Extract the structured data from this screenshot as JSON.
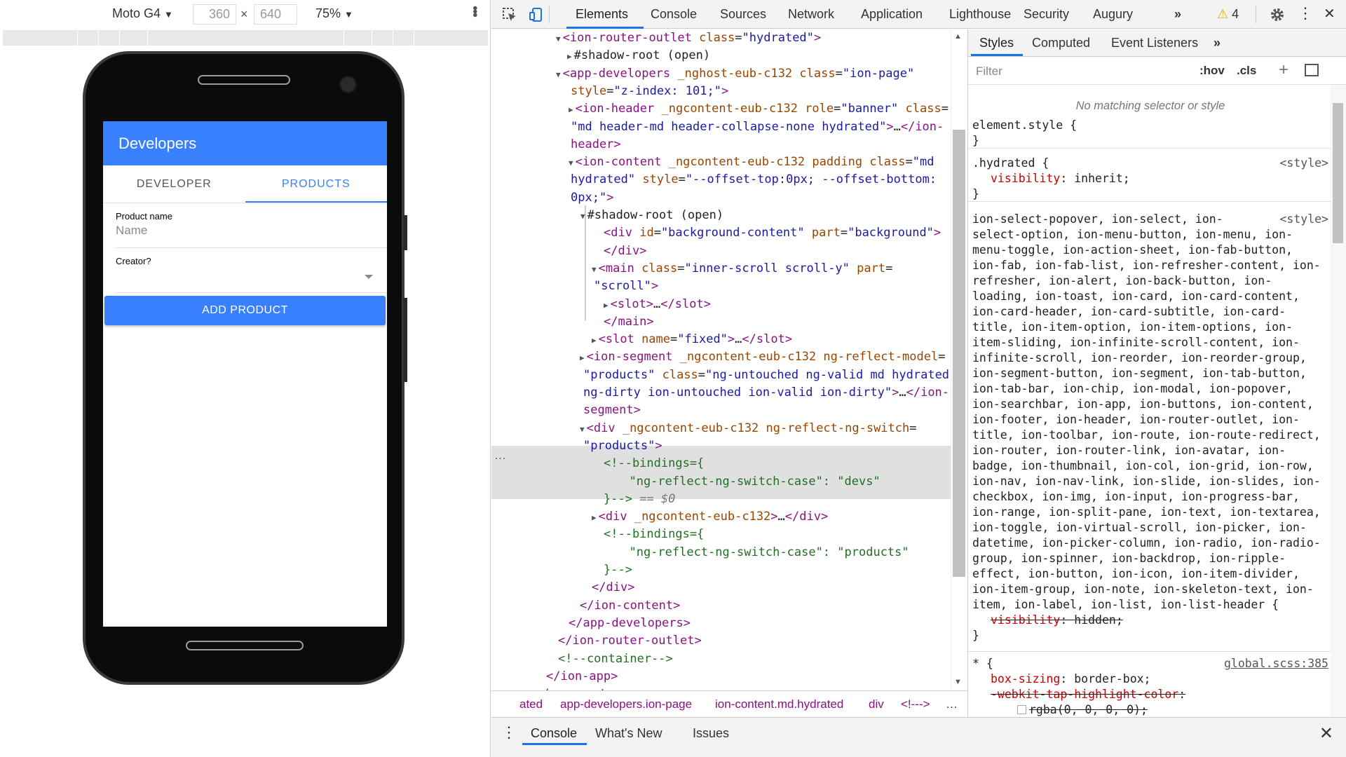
{
  "device_toolbar": {
    "device": "Moto G4",
    "width": "360",
    "height": "640",
    "times": "×",
    "zoom": "75%",
    "caret": "▼",
    "kebab": "•••"
  },
  "app": {
    "title": "Developers",
    "segments": [
      "DEVELOPER",
      "PRODUCTS"
    ],
    "product_name_label": "Product name",
    "product_name_placeholder": "Name",
    "creator_label": "Creator?",
    "add_button": "ADD PRODUCT",
    "accent": "#3880ff"
  },
  "devtools": {
    "tabs": [
      "Elements",
      "Console",
      "Sources",
      "Network",
      "Application",
      "Lighthouse",
      "Security",
      "Augury"
    ],
    "more": "»",
    "warning_icon": "⚠",
    "warning_count": "4",
    "menu_icon": "⋮",
    "close": "✕"
  },
  "elements_rows": [
    {
      "html": "<span class='tri-d'></span><span class='tag'>&lt;ion-router-outlet</span> <span class='attr'>class</span>=<span class='aval'>\"hydrated\"</span><span class='tag'>&gt;</span>"
    },
    {
      "html": "<span class='tri-r'></span>#shadow-root (open)"
    },
    {
      "html": "<span class='tri-d'></span><span class='tag'>&lt;app-developers</span> <span class='attr'>_nghost-eub-c132</span> <span class='attr'>class</span>=<span class='aval'>\"ion-page\"</span>"
    },
    {
      "html": "<span class='attr'>style</span>=<span class='aval'>\"z-index: 101;\"</span><span class='tag'>&gt;</span>"
    },
    {
      "html": "<span class='tri-r'></span><span class='tag'>&lt;ion-header</span> <span class='attr'>_ngcontent-eub-c132</span> <span class='attr'>role</span>=<span class='aval'>\"banner\"</span> <span class='attr'>class</span>="
    },
    {
      "html": "<span class='aval'>\"md header-md header-collapse-none hydrated\"</span><span class='tag'>&gt;</span>…<span class='tag'>&lt;/ion-</span>"
    },
    {
      "html": "<span class='tag'>header&gt;</span>"
    },
    {
      "html": "<span class='tri-d'></span><span class='tag'>&lt;ion-content</span> <span class='attr'>_ngcontent-eub-c132</span> <span class='attr'>padding</span> <span class='attr'>class</span>=<span class='aval'>\"md</span>"
    },
    {
      "html": "<span class='aval'>hydrated\"</span> <span class='attr'>style</span>=<span class='aval'>\"--offset-top:0px; --offset-bottom:</span>"
    },
    {
      "html": "<span class='aval'>0px;\"</span><span class='tag'>&gt;</span>"
    },
    {
      "html": "<span class='tri-d'></span>#shadow-root (open)"
    },
    {
      "html": "<span class='tag'>&lt;div</span> <span class='attr'>id</span>=<span class='aval'>\"background-content\"</span> <span class='attr'>part</span>=<span class='aval'>\"background\"</span><span class='tag'>&gt;</span>"
    },
    {
      "html": "<span class='tag'>&lt;/div&gt;</span>"
    },
    {
      "html": "<span class='tri-d'></span><span class='tag'>&lt;main</span> <span class='attr'>class</span>=<span class='aval'>\"inner-scroll scroll-y\"</span> <span class='attr'>part</span>="
    },
    {
      "html": "<span class='aval'>\"scroll\"</span><span class='tag'>&gt;</span>"
    },
    {
      "html": "<span class='tri-r'></span><span class='tag'>&lt;slot&gt;</span>…<span class='tag'>&lt;/slot&gt;</span>"
    },
    {
      "html": "<span class='tag'>&lt;/main&gt;</span>"
    },
    {
      "html": "<span class='tri-r'></span><span class='tag'>&lt;slot</span> <span class='attr'>name</span>=<span class='aval'>\"fixed\"</span><span class='tag'>&gt;</span>…<span class='tag'>&lt;/slot&gt;</span>"
    },
    {
      "html": "<span class='tri-r'></span><span class='tag'>&lt;ion-segment</span> <span class='attr'>_ngcontent-eub-c132</span> <span class='attr'>ng-reflect-model</span>="
    },
    {
      "html": "<span class='aval'>\"products\"</span> <span class='attr'>class</span>=<span class='aval'>\"ng-untouched ng-valid md hydrated</span>"
    },
    {
      "html": "<span class='aval'>ng-dirty ion-untouched ion-valid ion-dirty\"</span><span class='tag'>&gt;</span>…<span class='tag'>&lt;/ion-</span>"
    },
    {
      "html": "<span class='tag'>segment&gt;</span>"
    },
    {
      "html": "<span class='tri-d'></span><span class='tag'>&lt;div</span> <span class='attr'>_ngcontent-eub-c132</span> <span class='attr'>ng-reflect-ng-switch</span>="
    },
    {
      "html": "<span class='aval'>\"products\"</span><span class='tag'>&gt;</span>"
    },
    {
      "html": "<span class='cmt'>&lt;!--bindings={</span>"
    },
    {
      "html": "<span class='cmt'>  \"ng-reflect-ng-switch-case\": \"devs\"</span>"
    },
    {
      "html": "<span class='cmt'>}--&gt;</span> <span style='color:#777;font-style:italic'>== $0</span>"
    },
    {
      "html": "<span class='tri-r'></span><span class='tag'>&lt;div</span> <span class='attr'>_ngcontent-eub-c132</span><span class='tag'>&gt;</span>…<span class='tag'>&lt;/div&gt;</span>"
    },
    {
      "html": "<span class='cmt'>&lt;!--bindings={</span>"
    },
    {
      "html": "<span class='cmt'>  \"ng-reflect-ng-switch-case\": \"products\"</span>"
    },
    {
      "html": "<span class='cmt'>}--&gt;</span>"
    },
    {
      "html": "<span class='tag'>&lt;/div&gt;</span>"
    },
    {
      "html": "<span class='tag'>&lt;/ion-content&gt;</span>"
    },
    {
      "html": "<span class='tag'>&lt;/app-developers&gt;</span>"
    },
    {
      "html": "<span class='tag'>&lt;/ion-router-outlet&gt;</span>"
    },
    {
      "html": "<span class='cmt'>&lt;!--container--&gt;</span>"
    },
    {
      "html": "<span class='tag'>&lt;/ion-app&gt;</span>"
    },
    {
      "html": "<span class='tag'>&lt;/app-root&gt;</span>"
    }
  ],
  "breadcrumbs": [
    "ated",
    "app-developers.ion-page",
    "ion-content.md.hydrated",
    "div",
    "<!--->",
    "…"
  ],
  "styles": {
    "tabs": [
      "Styles",
      "Computed",
      "Event Listeners",
      "»"
    ],
    "filter_placeholder": "Filter",
    "hov": ":hov",
    "cls": ".cls",
    "plus": "+",
    "no_match": "No matching selector or style",
    "element_style": "element.style {",
    "close_brace": "}",
    "hydrated_selector": ".hydrated {",
    "hydrated_prop": "visibility",
    "hydrated_val": "inherit;",
    "style_src": "<style>",
    "big_selector": [
      "ion-select-popover, ion-select, ion-",
      "select-option, ion-menu-button, ion-menu, ion-",
      "menu-toggle, ion-action-sheet, ion-fab-button,",
      "ion-fab, ion-fab-list, ion-refresher-content, ion-",
      "refresher, ion-alert, ion-back-button, ion-",
      "loading, ion-toast, ion-card, ion-card-content,",
      "ion-card-header, ion-card-subtitle, ion-card-",
      "title, ion-item-option, ion-item-options, ion-",
      "item-sliding, ion-infinite-scroll-content, ion-",
      "infinite-scroll, ion-reorder, ion-reorder-group,",
      "ion-segment-button, ion-segment, ion-tab-button,",
      "ion-tab-bar, ion-chip, ion-modal, ion-popover,",
      "ion-searchbar, ion-app, ion-buttons, ion-content,",
      "ion-footer, ion-header, ion-router-outlet, ion-",
      "title, ion-toolbar, ion-route, ion-route-redirect,",
      "ion-router, ion-router-link, ion-avatar, ion-",
      "badge, ion-thumbnail, ion-col, ion-grid, ion-row,",
      "ion-nav, ion-nav-link, ion-slide, ion-slides, ion-",
      "checkbox, ion-img, ion-input, ion-progress-bar,",
      "ion-range, ion-split-pane, ion-text, ion-textarea,",
      "ion-toggle, ion-virtual-scroll, ion-picker, ion-",
      "datetime, ion-picker-column, ion-radio, ion-radio-",
      "group, ion-spinner, ion-backdrop, ion-ripple-",
      "effect, ion-button, ion-icon, ion-item-divider,",
      "ion-item-group, ion-note, ion-skeleton-text, ion-",
      "item, ion-label, ion-list, ion-list-header {"
    ],
    "big_prop": "visibility",
    "big_val": "hidden;",
    "star_selector": "* {",
    "star_src": "global.scss:385",
    "star_prop1": "box-sizing",
    "star_val1": "border-box;",
    "star_prop2": "-webkit-tap-highlight-color",
    "star_val2": "rgba(0, 0, 0, 0);"
  },
  "drawer": {
    "menu": "⋮",
    "tabs": [
      "Console",
      "What's New",
      "Issues"
    ],
    "close": "✕"
  }
}
